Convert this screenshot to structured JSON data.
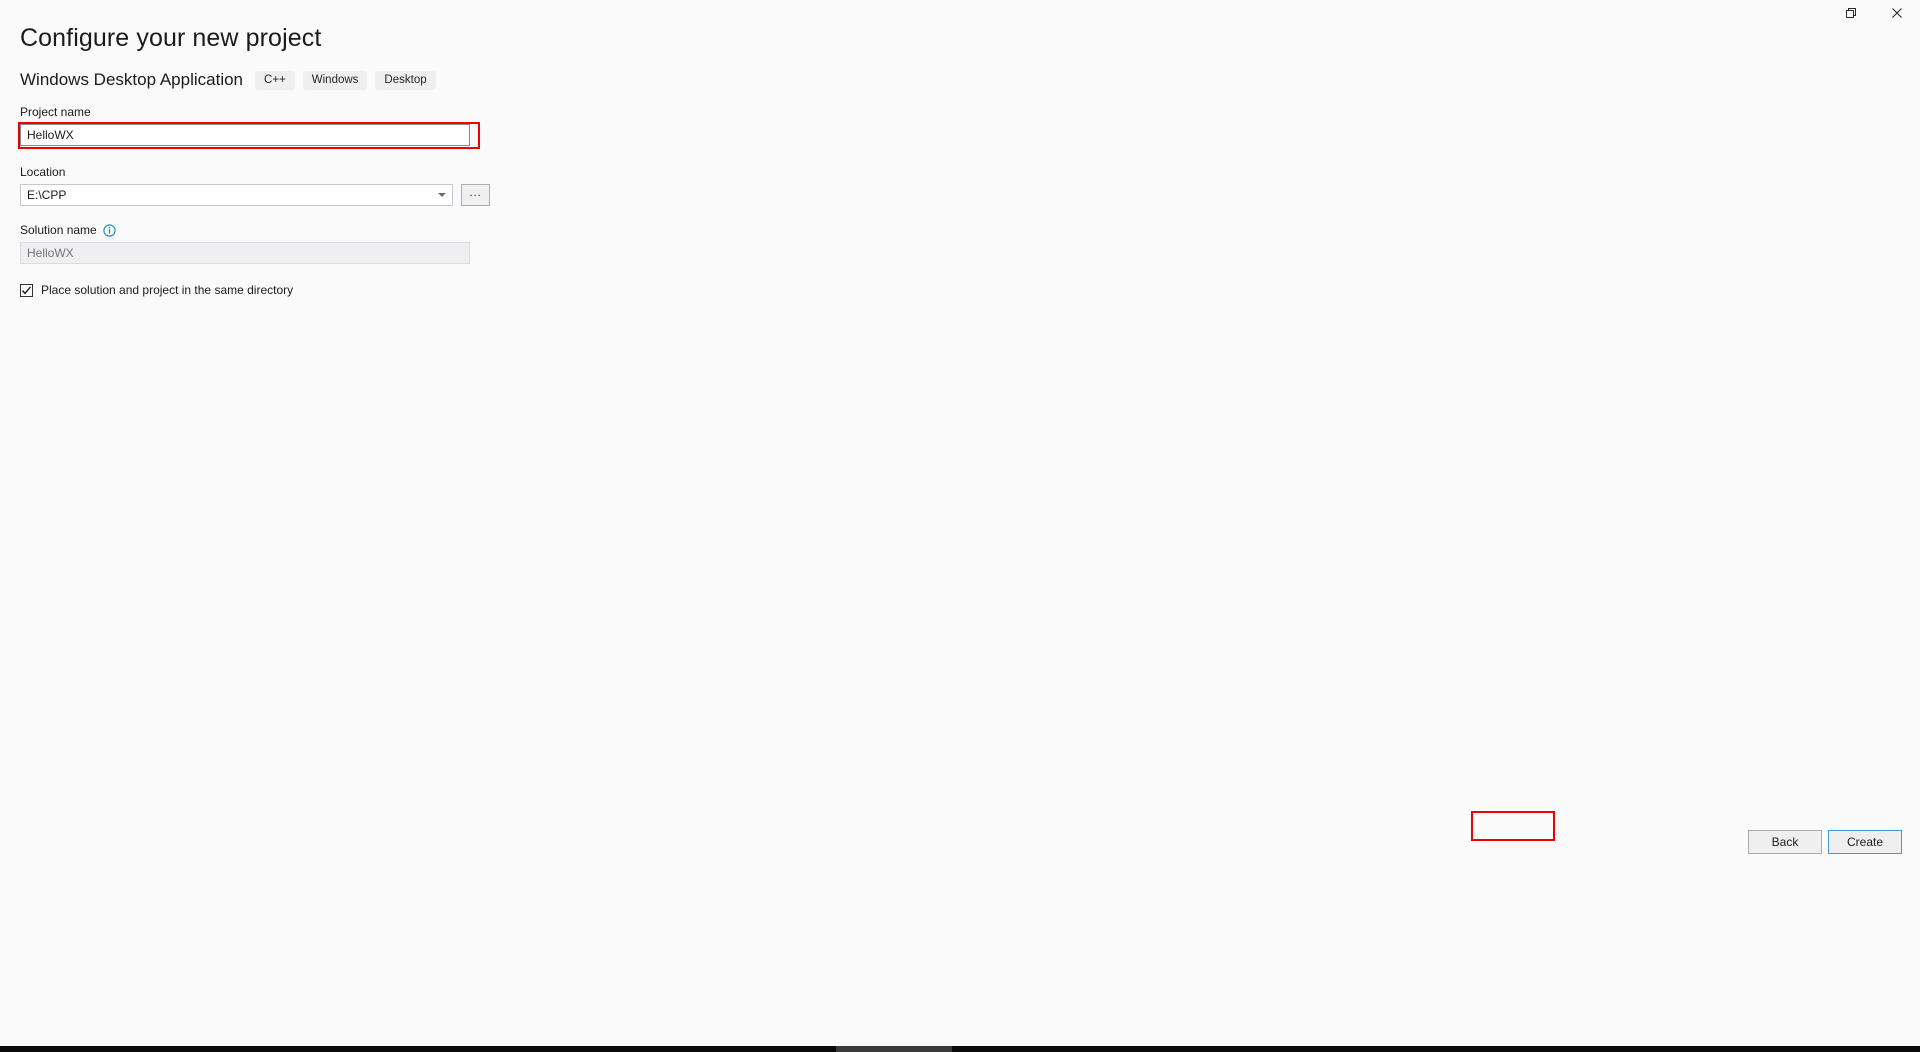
{
  "window": {
    "controls": [
      {
        "name": "restore-icon",
        "label": "Restore"
      },
      {
        "name": "close-icon",
        "label": "Close"
      }
    ]
  },
  "header": {
    "title": "Configure your new project",
    "template_name": "Windows Desktop Application",
    "tags": [
      "C++",
      "Windows",
      "Desktop"
    ]
  },
  "form": {
    "project_name": {
      "label": "Project name",
      "value": "HelloWX",
      "placeholder": ""
    },
    "location": {
      "label": "Location",
      "value": "E:\\CPP",
      "browse_label": "..."
    },
    "solution_name": {
      "label": "Solution name",
      "value": "",
      "placeholder": "HelloWX",
      "info_tooltip": "Solution name"
    },
    "same_directory": {
      "label": "Place solution and project in the same directory",
      "checked": true
    }
  },
  "footer": {
    "back_label": "Back",
    "create_label": "Create"
  },
  "annotations": {
    "accent_red": "#ee0000",
    "focus_blue": "#3f9bde"
  }
}
